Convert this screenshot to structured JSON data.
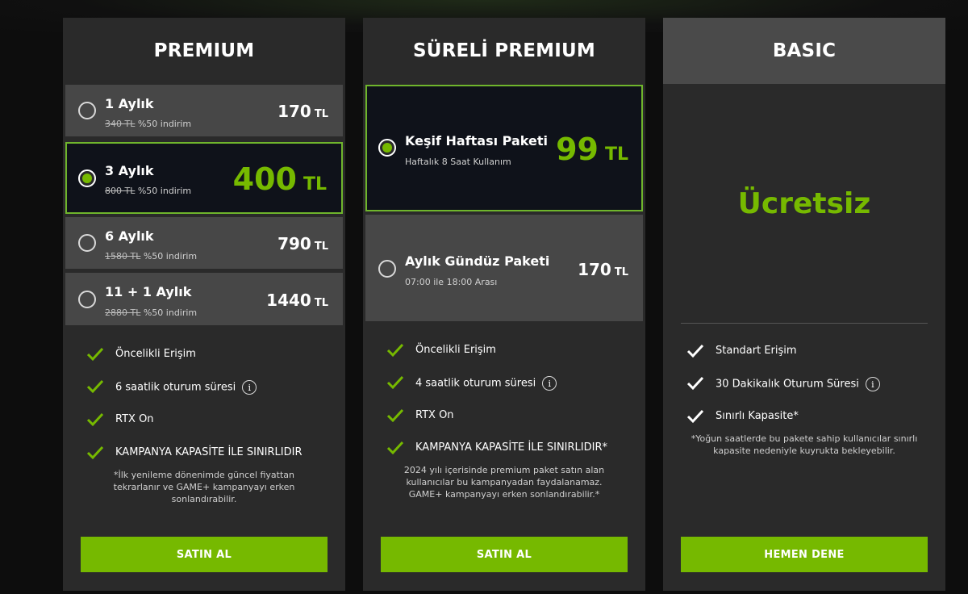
{
  "premium": {
    "title": "PREMIUM",
    "options": [
      {
        "name": "1 Aylık",
        "old_price": "340 TL",
        "discount": " %50 indirim",
        "price": "170",
        "currency": "TL",
        "selected": false
      },
      {
        "name": "3 Aylık",
        "old_price": "800 TL",
        "discount": " %50 indirim",
        "price": "400",
        "currency": "TL",
        "selected": true
      },
      {
        "name": "6 Aylık",
        "old_price": "1580 TL",
        "discount": " %50 indirim",
        "price": "790",
        "currency": "TL",
        "selected": false
      },
      {
        "name": "11 + 1 Aylık",
        "old_price": "2880 TL",
        "discount": " %50 indirim",
        "price": "1440",
        "currency": "TL",
        "selected": false
      }
    ],
    "features": [
      "Öncelikli Erişim",
      "6 saatlik oturum süresi",
      "RTX On",
      "KAMPANYA KAPASİTE İLE SINIRLIDIR"
    ],
    "note": "*İlk yenileme dönenimde güncel fiyattan tekrarlanır ve GAME+ kampanyayı erken sonlandırabilir.",
    "button": "SATIN AL"
  },
  "sureli": {
    "title": "SÜRELİ PREMIUM",
    "options": [
      {
        "name": "Keşif Haftası Paketi",
        "sub": "Haftalık 8 Saat Kullanım",
        "price": "99",
        "currency": "TL",
        "selected": true
      },
      {
        "name": "Aylık Gündüz Paketi",
        "sub": "07:00 ile 18:00 Arası",
        "price": "170",
        "currency": "TL",
        "selected": false
      }
    ],
    "features": [
      "Öncelikli Erişim",
      "4 saatlik oturum süresi",
      "RTX On",
      "KAMPANYA KAPASİTE İLE SINIRLIDIR*"
    ],
    "note": "2024 yılı içerisinde premium paket satın alan kullanıcılar bu kampanyadan faydalanamaz. GAME+ kampanyayı erken sonlandırabilir.*",
    "button": "SATIN AL"
  },
  "basic": {
    "title": "BASIC",
    "price_label": "Ücretsiz",
    "features": [
      "Standart Erişim",
      "30 Dakikalık Oturum Süresi",
      "Sınırlı Kapasite*"
    ],
    "note": "*Yoğun saatlerde bu pakete sahip kullanıcılar sınırlı kapasite nedeniyle kuyrukta bekleyebilir.",
    "button": "HEMEN DENE"
  },
  "info_icon": "i",
  "colors": {
    "accent": "#76b900",
    "card": "#2a2a2a",
    "option": "#474747",
    "selected_option": "#0f121a"
  },
  "icons": {
    "check": "check-icon",
    "info": "info-icon",
    "radio": "radio-icon"
  }
}
